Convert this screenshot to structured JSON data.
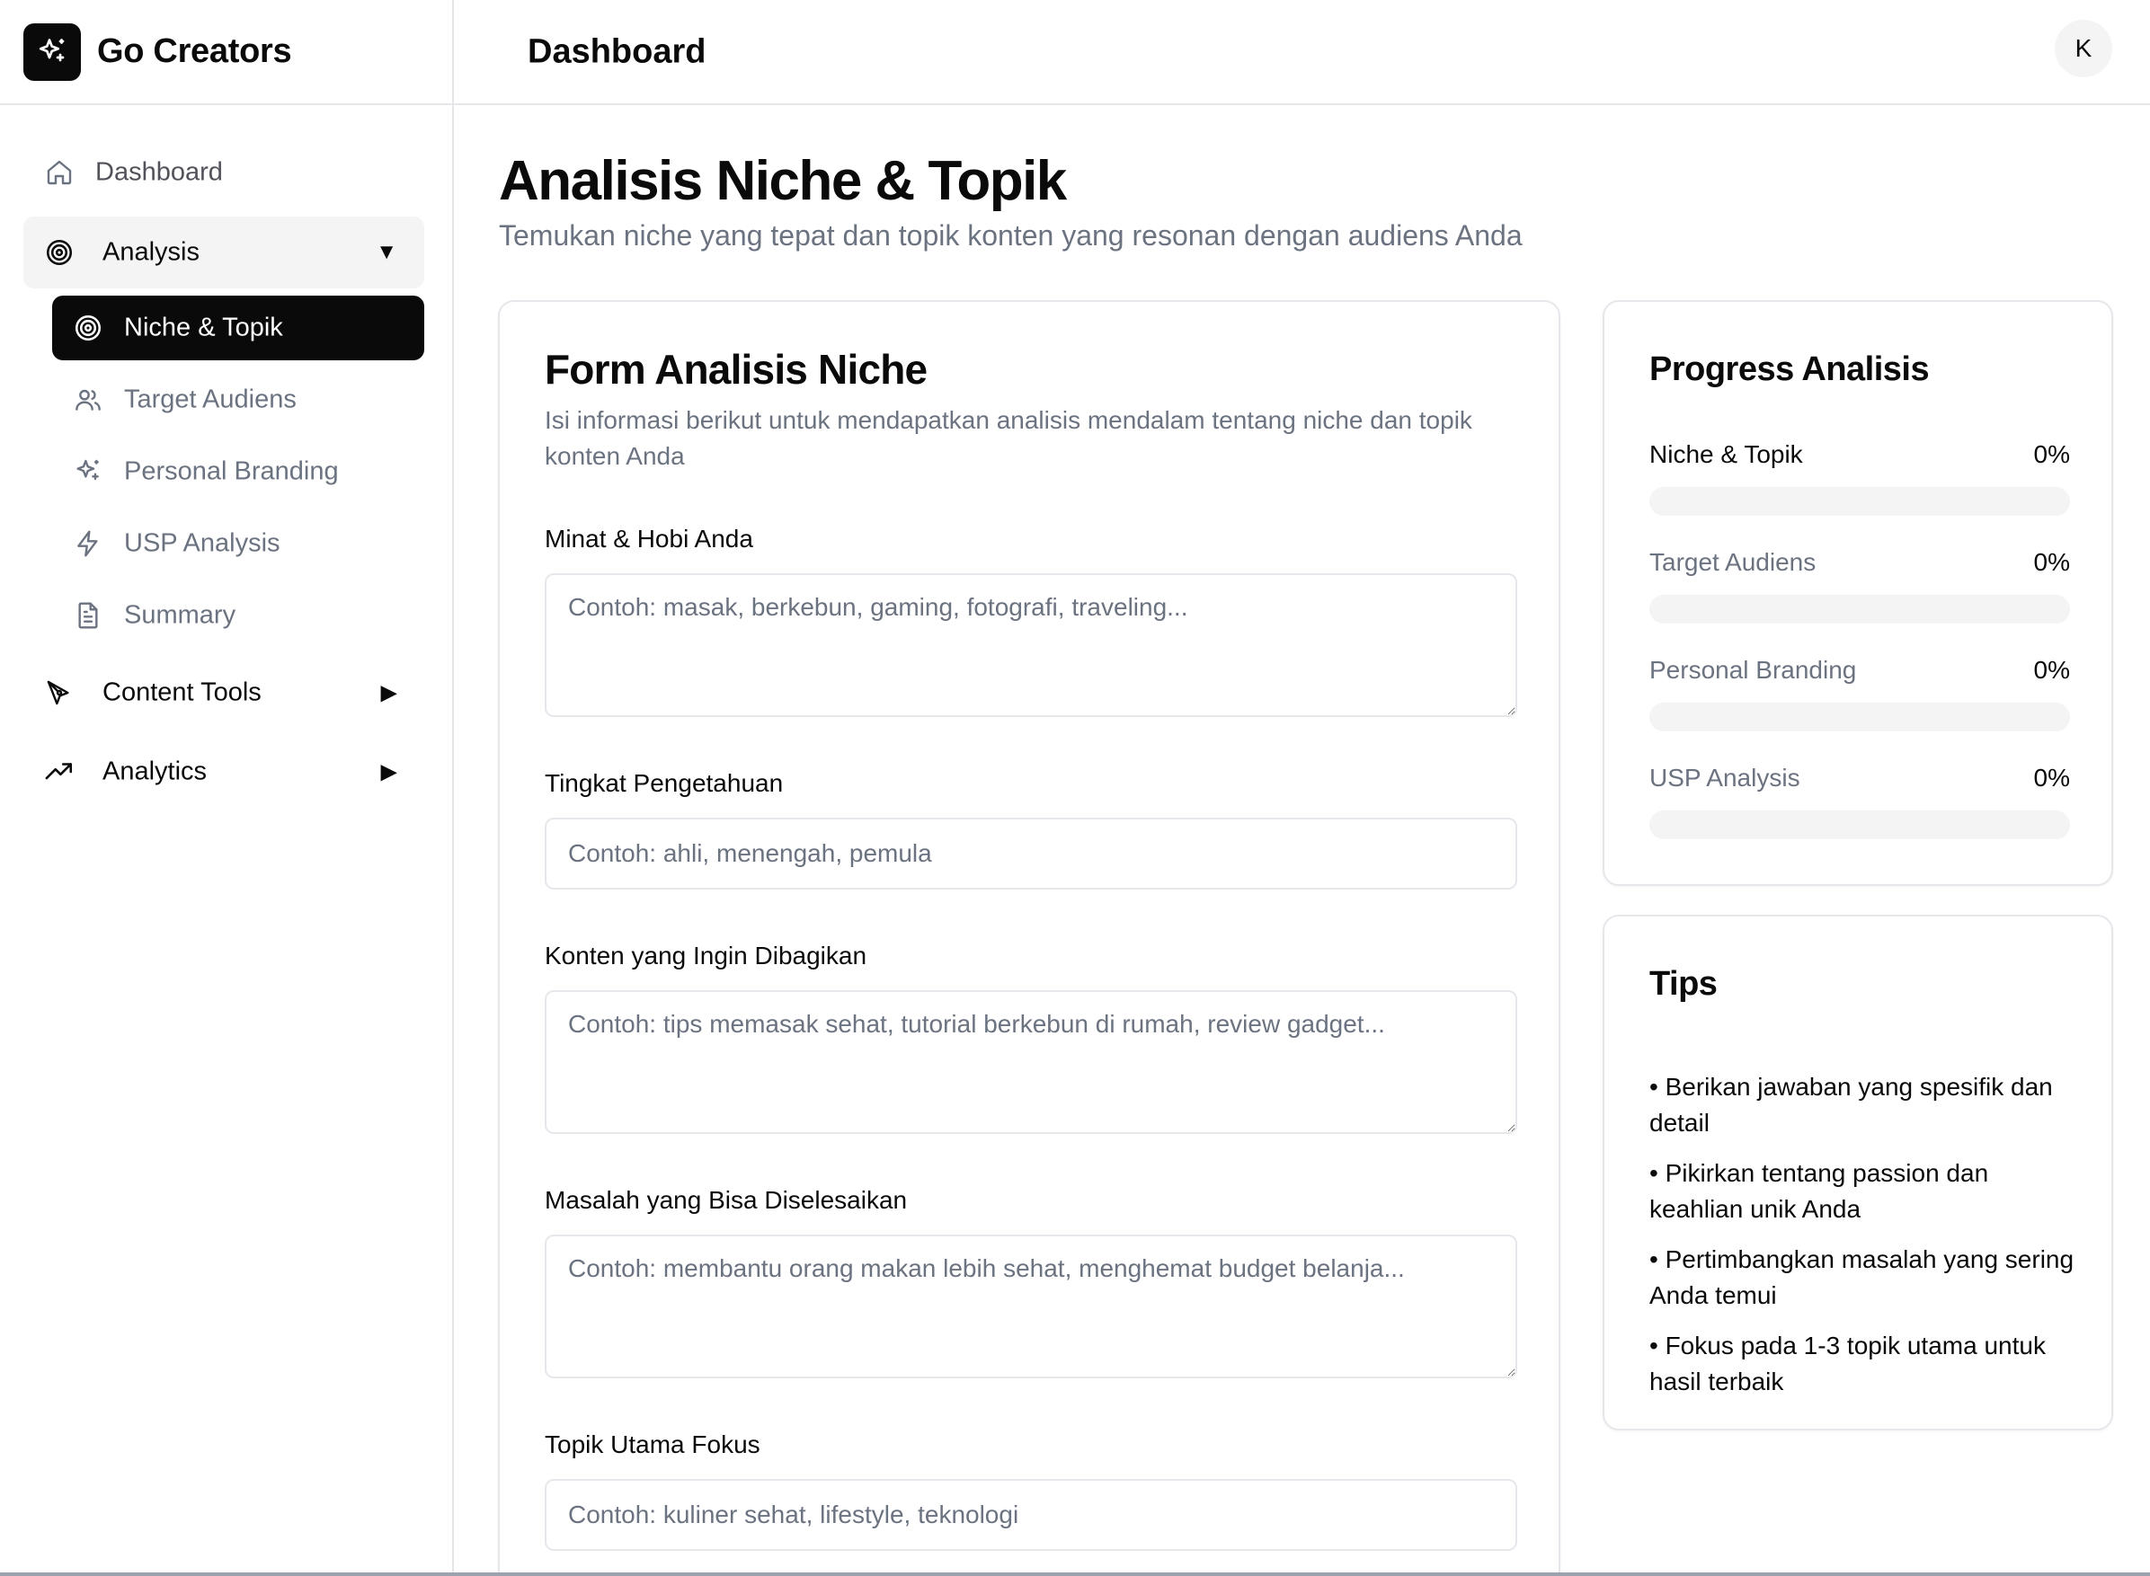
{
  "app": {
    "name": "Go Creators",
    "user_initial": "K"
  },
  "header": {
    "title": "Dashboard"
  },
  "sidebar": {
    "dashboard": "Dashboard",
    "analysis": {
      "label": "Analysis",
      "items": [
        "Niche & Topik",
        "Target Audiens",
        "Personal Branding",
        "USP Analysis",
        "Summary"
      ]
    },
    "content_tools": "Content Tools",
    "analytics": "Analytics"
  },
  "page": {
    "title": "Analisis Niche & Topik",
    "subtitle": "Temukan niche yang tepat dan topik konten yang resonan dengan audiens Anda"
  },
  "form": {
    "title": "Form Analisis Niche",
    "description": "Isi informasi berikut untuk mendapatkan analisis mendalam tentang niche dan topik konten Anda",
    "fields": [
      {
        "label": "Minat & Hobi Anda",
        "placeholder": "Contoh: masak, berkebun, gaming, fotografi, traveling..."
      },
      {
        "label": "Tingkat Pengetahuan",
        "placeholder": "Contoh: ahli, menengah, pemula"
      },
      {
        "label": "Konten yang Ingin Dibagikan",
        "placeholder": "Contoh: tips memasak sehat, tutorial berkebun di rumah, review gadget..."
      },
      {
        "label": "Masalah yang Bisa Diselesaikan",
        "placeholder": "Contoh: membantu orang makan lebih sehat, menghemat budget belanja..."
      },
      {
        "label": "Topik Utama Fokus",
        "placeholder": "Contoh: kuliner sehat, lifestyle, teknologi"
      }
    ]
  },
  "progress": {
    "title": "Progress Analisis",
    "items": [
      {
        "label": "Niche & Topik",
        "value": "0%",
        "fraction": 0
      },
      {
        "label": "Target Audiens",
        "value": "0%",
        "fraction": 0
      },
      {
        "label": "Personal Branding",
        "value": "0%",
        "fraction": 0
      },
      {
        "label": "USP Analysis",
        "value": "0%",
        "fraction": 0
      }
    ]
  },
  "tips": {
    "title": "Tips",
    "items": [
      "• Berikan jawaban yang spesifik dan detail",
      "• Pikirkan tentang passion dan keahlian unik Anda",
      "• Pertimbangkan masalah yang sering Anda temui",
      "• Fokus pada 1-3 topik utama untuk hasil terbaik"
    ]
  },
  "icons": {
    "brand": "sparkles-icon",
    "dashboard": "home-icon",
    "analysis": "target-icon",
    "niche": "target-icon",
    "audience": "users-icon",
    "branding": "sparkles-icon",
    "usp": "zap-icon",
    "summary": "file-text-icon",
    "content_tools": "pen-tool-icon",
    "analytics": "trending-up-icon"
  },
  "colors": {
    "primary": "#0a0a0a",
    "muted": "#6b7280",
    "border": "#e5e7eb",
    "track": "#f4f4f5"
  }
}
